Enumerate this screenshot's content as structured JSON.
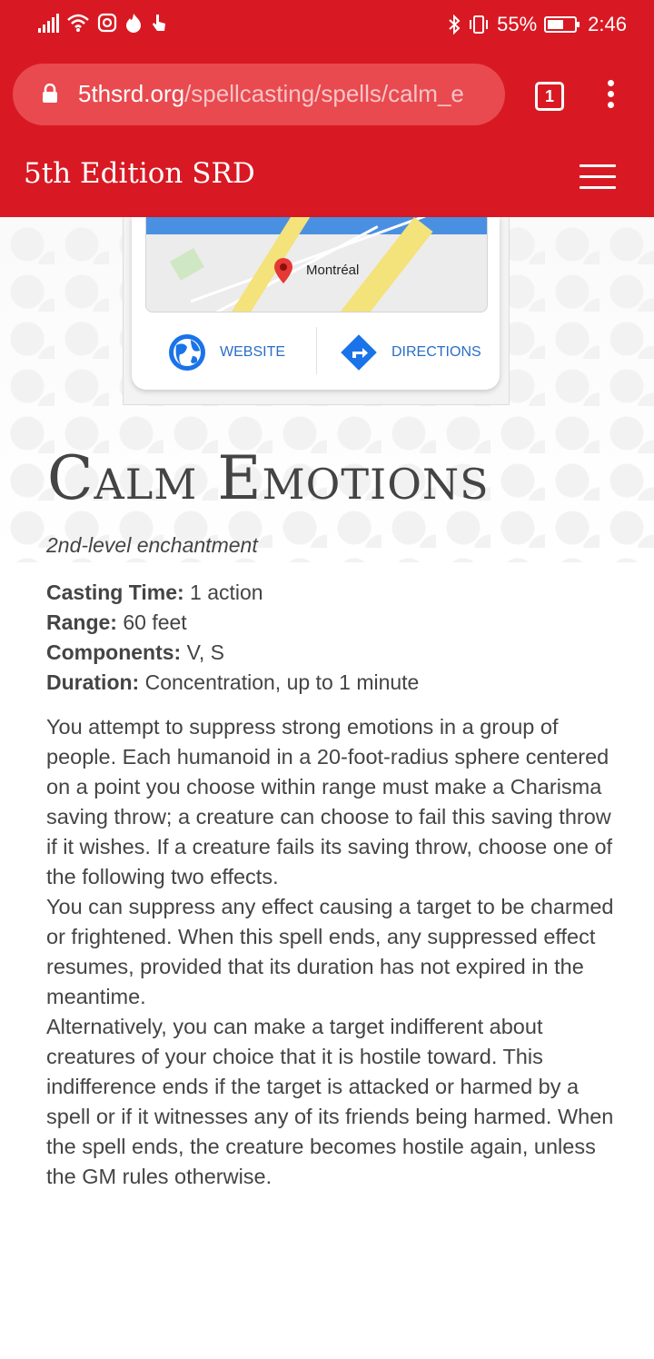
{
  "status_bar": {
    "battery_percent": "55%",
    "time": "2:46"
  },
  "browser": {
    "url_domain": "5thsrd.org",
    "url_path": "/spellcasting/spells/calm_e",
    "tab_count": "1"
  },
  "app": {
    "title": "5th Edition SRD"
  },
  "ad": {
    "map_label": "Montréal",
    "website_label": "WEBSITE",
    "directions_label": "DIRECTIONS"
  },
  "spell": {
    "title": "Calm Emotions",
    "level": "2nd-level enchantment",
    "properties": [
      {
        "label": "Casting Time:",
        "value": " 1 action"
      },
      {
        "label": "Range:",
        "value": " 60 feet"
      },
      {
        "label": "Components:",
        "value": " V, S"
      },
      {
        "label": "Duration:",
        "value": " Concentration, up to 1 minute"
      }
    ],
    "paragraphs": [
      "You attempt to suppress strong emotions in a group of people. Each humanoid in a 20-foot-radius sphere centered on a point you choose within range must make a Charisma saving throw; a creature can choose to fail this saving throw if it wishes. If a creature fails its saving throw, choose one of the following two effects.",
      "You can suppress any effect causing a target to be charmed or frightened. When this spell ends, any suppressed effect resumes, provided that its duration has not expired in the meantime.",
      "Alternatively, you can make a target indifferent about creatures of your choice that it is hostile toward. This indifference ends if the target is attacked or harmed by a spell or if it witnesses any of its friends being harmed. When the spell ends, the creature becomes hostile again, unless the GM rules otherwise."
    ]
  },
  "colors": {
    "brand_red": "#d81923",
    "link_blue": "#2a6ec8"
  }
}
